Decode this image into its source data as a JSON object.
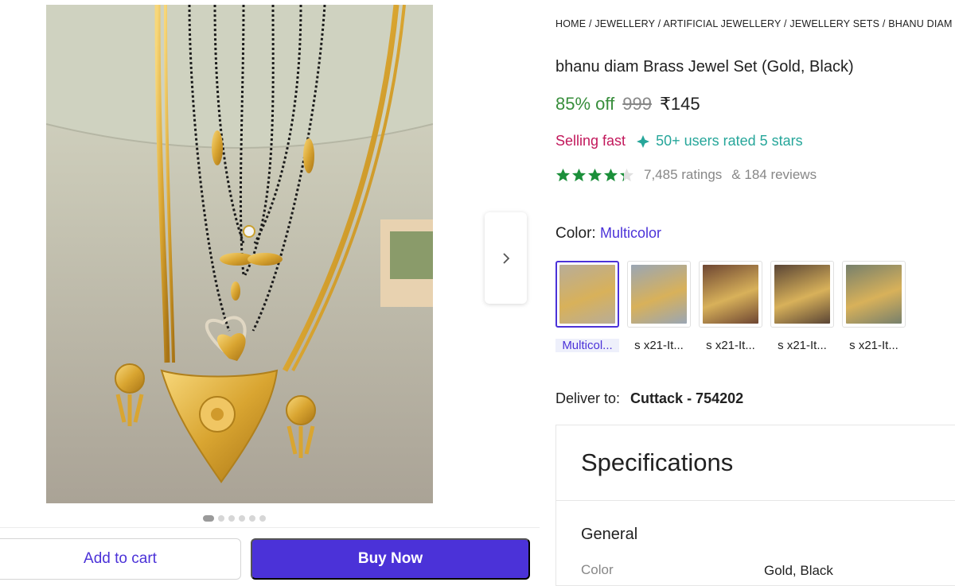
{
  "breadcrumb": "HOME / JEWELLERY / ARTIFICIAL JEWELLERY / JEWELLERY SETS / BHANU DIAM",
  "product": {
    "title": "bhanu diam Brass Jewel Set (Gold, Black)",
    "discount": "85% off",
    "mrp": "999",
    "price": "₹145",
    "selling_fast": "Selling fast",
    "users_rated": "50+ users rated 5 stars",
    "rating_value": 4.3,
    "ratings": "7,485 ratings",
    "reviews": "& 184 reviews"
  },
  "image_carousel": {
    "count": 6,
    "active_index": 0
  },
  "color": {
    "label": "Color:",
    "selected": "Multicolor",
    "options": [
      {
        "label": "Multicol...",
        "selected": true,
        "bg": "#b8ad98"
      },
      {
        "label": "s x21-It...",
        "selected": false,
        "bg": "#9aa6b4"
      },
      {
        "label": "s x21-It...",
        "selected": false,
        "bg": "#6e4632"
      },
      {
        "label": "s x21-It...",
        "selected": false,
        "bg": "#5a4535"
      },
      {
        "label": "s x21-It...",
        "selected": false,
        "bg": "#77806c"
      }
    ]
  },
  "delivery": {
    "label": "Deliver to:",
    "location": "Cuttack - 754202"
  },
  "actions": {
    "add_to_cart": "Add to cart",
    "buy_now": "Buy Now"
  },
  "specifications": {
    "title": "Specifications",
    "group": "General",
    "rows": [
      {
        "key": "Color",
        "value": "Gold, Black"
      }
    ]
  },
  "colors": {
    "accent": "#4b32d8",
    "discount_green": "#388e3c",
    "star_green": "#1b8f3a",
    "selling_fast": "#c2185b",
    "users_rated": "#26a69a"
  }
}
